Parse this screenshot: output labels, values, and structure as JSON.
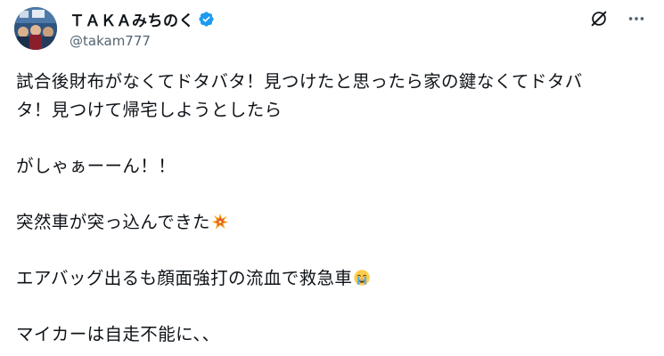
{
  "author": {
    "display_name": "ＴＡＫＡみちのく",
    "handle": "@takam777",
    "verified": true,
    "avatar_icon": "avatar-photo"
  },
  "actions": {
    "grok_icon": "grok-icon",
    "more_icon": "more-options-icon"
  },
  "post": {
    "paragraphs": [
      {
        "lines": [
          "試合後財布がなくてドタバタ！見つけたと思ったら家の鍵なくてドタバ",
          "タ！見つけて帰宅しようとしたら"
        ]
      },
      {
        "lines": [
          "がしゃぁーーん！！"
        ]
      },
      {
        "lines": [
          "突然車が突っ込んできた"
        ],
        "emoji": "collision-emoji"
      },
      {
        "lines": [
          "エアバッグ出るも顔面強打の流血で救急車"
        ],
        "emoji": "crying-face-emoji"
      },
      {
        "lines": [
          "マイカーは自走不能に、、"
        ]
      }
    ]
  },
  "colors": {
    "text": "#0f1419",
    "secondary_text": "#536471",
    "verified_blue": "#1d9bf0"
  }
}
